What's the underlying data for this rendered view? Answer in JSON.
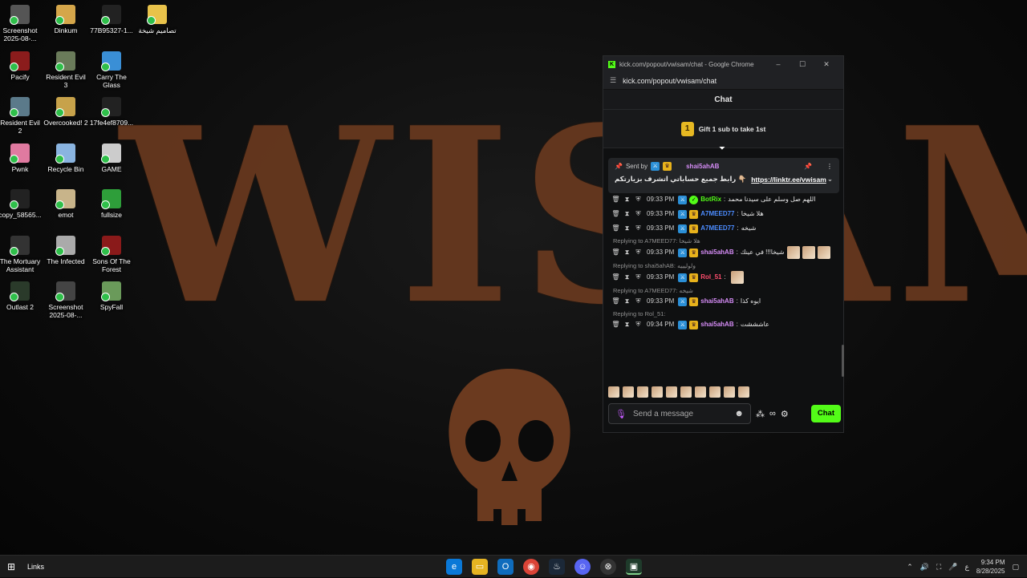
{
  "desktop": {
    "wallpaper_text": "WISAM",
    "icons": [
      {
        "label": "Screenshot 2025-08-...",
        "color": "#555"
      },
      {
        "label": "Dinkum",
        "color": "#d5a64a"
      },
      {
        "label": "77B95327-1...",
        "color": "#222"
      },
      {
        "label": "تصاميم شيخة",
        "color": "#e8c24a"
      },
      {
        "label": "Pacify",
        "color": "#8b1c1c"
      },
      {
        "label": "Resident Evil 3",
        "color": "#6a7b5a"
      },
      {
        "label": "Carry The Glass",
        "color": "#3a8fd6"
      },
      {
        "label": "Resident Evil 2",
        "color": "#5b7a8a"
      },
      {
        "label": "Overcooked! 2",
        "color": "#c7a24a"
      },
      {
        "label": "17fe4ef8709...",
        "color": "#222"
      },
      {
        "label": "Pwnk",
        "color": "#e07aa0"
      },
      {
        "label": "Recycle Bin",
        "color": "#8ab4e0"
      },
      {
        "label": "GAME",
        "color": "#ccc"
      },
      {
        "label": "copy_58565...",
        "color": "#222"
      },
      {
        "label": "emot",
        "color": "#c8b48a"
      },
      {
        "label": "fullsize",
        "color": "#2e9e3a"
      },
      {
        "label": "The Mortuary Assistant",
        "color": "#333"
      },
      {
        "label": "The Infected",
        "color": "#aaa"
      },
      {
        "label": "Sons Of The Forest",
        "color": "#8a1a1a"
      },
      {
        "label": "Outlast 2",
        "color": "#2a3a2a"
      },
      {
        "label": "Screenshot 2025-08-...",
        "color": "#444"
      },
      {
        "label": "SpyFall",
        "color": "#6a9a5a"
      }
    ]
  },
  "browser": {
    "title": "kick.com/popout/vwisam/chat - Google Chrome",
    "url": "kick.com/popout/vwisam/chat",
    "minimize": "–",
    "maximize": "☐",
    "close": "✕"
  },
  "chat": {
    "header": "Chat",
    "gift_banner": {
      "count": "1",
      "text": "Gift 1 sub to take 1st"
    },
    "pinned": {
      "sent_by": "Sent by",
      "user": "shai5ahAB",
      "text": "رابط جميع حساباتي اتشرف بزيارتكم 👇🏼",
      "link": "https://linktr.ee/vwisam"
    },
    "messages": [
      {
        "reply": "",
        "time": "09:33 PM",
        "user": "BotRix",
        "user_color": "#53fc18",
        "text": "اللهم صل وسلم على سيدنا محمد",
        "verified": true,
        "emotes": 0
      },
      {
        "reply": "",
        "time": "09:33 PM",
        "user": "A7MEED77",
        "user_color": "#4c8cff",
        "text": "هلا شيخا",
        "verified": false,
        "emotes": 0
      },
      {
        "reply": "",
        "time": "09:33 PM",
        "user": "A7MEED77",
        "user_color": "#4c8cff",
        "text": "شيخه",
        "verified": false,
        "emotes": 0
      },
      {
        "reply": "Replying to A7MEED77: هلا شيخا",
        "time": "09:33 PM",
        "user": "shai5ahAB",
        "user_color": "#d58cf6",
        "text": "شيخا!!! في عينك",
        "verified": false,
        "emotes": 3
      },
      {
        "reply": "Replying to shai5ahAB: ولوليييه",
        "time": "09:33 PM",
        "user": "Rol_51",
        "user_color": "#ff4d6d",
        "text": "",
        "verified": false,
        "emotes": 1
      },
      {
        "reply": "Replying to A7MEED77: شيخه",
        "time": "09:33 PM",
        "user": "shai5ahAB",
        "user_color": "#d58cf6",
        "text": "ايوه كذا",
        "verified": false,
        "emotes": 0
      },
      {
        "reply": "Replying to Rol_51:",
        "time": "09:34 PM",
        "user": "shai5ahAB",
        "user_color": "#d58cf6",
        "text": "عاشششت",
        "verified": false,
        "emotes": 0
      }
    ],
    "input_placeholder": "Send a message",
    "send_label": "Chat"
  },
  "taskbar": {
    "links_label": "Links",
    "time": "9:34 PM",
    "date": "8/28/2025",
    "lang": "ع"
  }
}
